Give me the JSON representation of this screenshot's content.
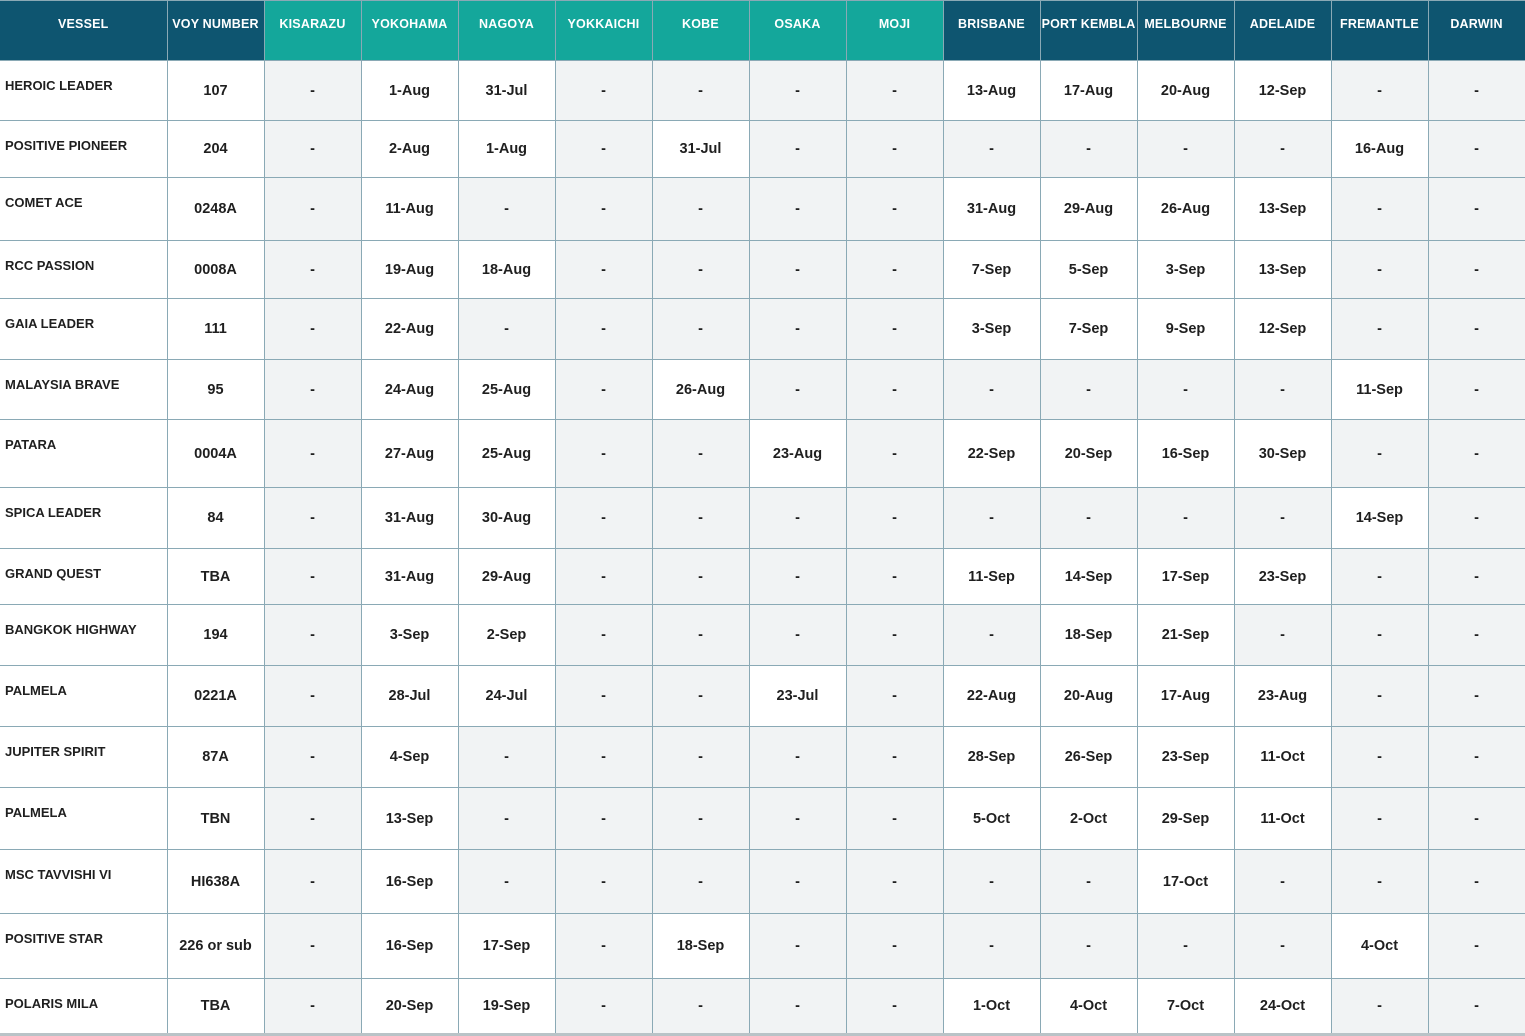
{
  "table": {
    "headers": [
      {
        "label": "VESSEL",
        "group": "navy"
      },
      {
        "label": "VOY NUMBER",
        "group": "navy"
      },
      {
        "label": "KISARAZU",
        "group": "teal"
      },
      {
        "label": "YOKOHAMA",
        "group": "teal"
      },
      {
        "label": "NAGOYA",
        "group": "teal"
      },
      {
        "label": "YOKKAICHI",
        "group": "teal"
      },
      {
        "label": "KOBE",
        "group": "teal"
      },
      {
        "label": "OSAKA",
        "group": "teal"
      },
      {
        "label": "MOJI",
        "group": "teal"
      },
      {
        "label": "BRISBANE",
        "group": "navy"
      },
      {
        "label": "PORT KEMBLA",
        "group": "navy"
      },
      {
        "label": "MELBOURNE",
        "group": "navy"
      },
      {
        "label": "ADELAIDE",
        "group": "navy"
      },
      {
        "label": "FREMANTLE",
        "group": "navy"
      },
      {
        "label": "DARWIN",
        "group": "navy"
      }
    ],
    "rows": [
      {
        "vessel": "HEROIC LEADER",
        "voy": "107",
        "ports": [
          "-",
          "1-Aug",
          "31-Jul",
          "-",
          "-",
          "-",
          "-",
          "13-Aug",
          "17-Aug",
          "20-Aug",
          "12-Sep",
          "-",
          "-"
        ]
      },
      {
        "vessel": "POSITIVE PIONEER",
        "voy": "204",
        "ports": [
          "-",
          "2-Aug",
          "1-Aug",
          "-",
          "31-Jul",
          "-",
          "-",
          "-",
          "-",
          "-",
          "-",
          "16-Aug",
          "-"
        ]
      },
      {
        "vessel": "COMET ACE",
        "voy": "0248A",
        "ports": [
          "-",
          "11-Aug",
          "-",
          "-",
          "-",
          "-",
          "-",
          "31-Aug",
          "29-Aug",
          "26-Aug",
          "13-Sep",
          "-",
          "-"
        ]
      },
      {
        "vessel": "RCC PASSION",
        "voy": "0008A",
        "ports": [
          "-",
          "19-Aug",
          "18-Aug",
          "-",
          "-",
          "-",
          "-",
          "7-Sep",
          "5-Sep",
          "3-Sep",
          "13-Sep",
          "-",
          "-"
        ]
      },
      {
        "vessel": "GAIA LEADER",
        "voy": "111",
        "ports": [
          "-",
          "22-Aug",
          "-",
          "-",
          "-",
          "-",
          "-",
          "3-Sep",
          "7-Sep",
          "9-Sep",
          "12-Sep",
          "-",
          "-"
        ]
      },
      {
        "vessel": "MALAYSIA BRAVE",
        "voy": "95",
        "ports": [
          "-",
          "24-Aug",
          "25-Aug",
          "-",
          "26-Aug",
          "-",
          "-",
          "-",
          "-",
          "-",
          "-",
          "11-Sep",
          "-"
        ]
      },
      {
        "vessel": "PATARA",
        "voy": "0004A",
        "ports": [
          "-",
          "27-Aug",
          "25-Aug",
          "-",
          "-",
          "23-Aug",
          "-",
          "22-Sep",
          "20-Sep",
          "16-Sep",
          "30-Sep",
          "-",
          "-"
        ]
      },
      {
        "vessel": "SPICA LEADER",
        "voy": "84",
        "ports": [
          "-",
          "31-Aug",
          "30-Aug",
          "-",
          "-",
          "-",
          "-",
          "-",
          "-",
          "-",
          "-",
          "14-Sep",
          "-"
        ]
      },
      {
        "vessel": "GRAND QUEST",
        "voy": "TBA",
        "ports": [
          "-",
          "31-Aug",
          "29-Aug",
          "-",
          "-",
          "-",
          "-",
          "11-Sep",
          "14-Sep",
          "17-Sep",
          "23-Sep",
          "-",
          "-"
        ]
      },
      {
        "vessel": "BANGKOK HIGHWAY",
        "voy": "194",
        "ports": [
          "-",
          "3-Sep",
          "2-Sep",
          "-",
          "-",
          "-",
          "-",
          "-",
          "18-Sep",
          "21-Sep",
          "-",
          "-",
          "-"
        ]
      },
      {
        "vessel": "PALMELA",
        "voy": "0221A",
        "ports": [
          "-",
          "28-Jul",
          "24-Jul",
          "-",
          "-",
          "23-Jul",
          "-",
          "22-Aug",
          "20-Aug",
          "17-Aug",
          "23-Aug",
          "-",
          "-"
        ]
      },
      {
        "vessel": "JUPITER SPIRIT",
        "voy": "87A",
        "ports": [
          "-",
          "4-Sep",
          "-",
          "-",
          "-",
          "-",
          "-",
          "28-Sep",
          "26-Sep",
          "23-Sep",
          "11-Oct",
          "-",
          "-"
        ]
      },
      {
        "vessel": "PALMELA",
        "voy": "TBN",
        "ports": [
          "-",
          "13-Sep",
          "-",
          "-",
          "-",
          "-",
          "-",
          "5-Oct",
          "2-Oct",
          "29-Sep",
          "11-Oct",
          "-",
          "-"
        ]
      },
      {
        "vessel": "MSC TAVVISHI VI",
        "voy": "HI638A",
        "ports": [
          "-",
          "16-Sep",
          "-",
          "-",
          "-",
          "-",
          "-",
          "-",
          "-",
          "17-Oct",
          "-",
          "-",
          "-"
        ]
      },
      {
        "vessel": "POSITIVE STAR",
        "voy": "226 or sub",
        "ports": [
          "-",
          "16-Sep",
          "17-Sep",
          "-",
          "18-Sep",
          "-",
          "-",
          "-",
          "-",
          "-",
          "-",
          "4-Oct",
          "-"
        ]
      },
      {
        "vessel": "POLARIS MILA",
        "voy": "TBA",
        "ports": [
          "-",
          "20-Sep",
          "19-Sep",
          "-",
          "-",
          "-",
          "-",
          "1-Oct",
          "4-Oct",
          "7-Oct",
          "24-Oct",
          "-",
          "-"
        ]
      }
    ]
  }
}
